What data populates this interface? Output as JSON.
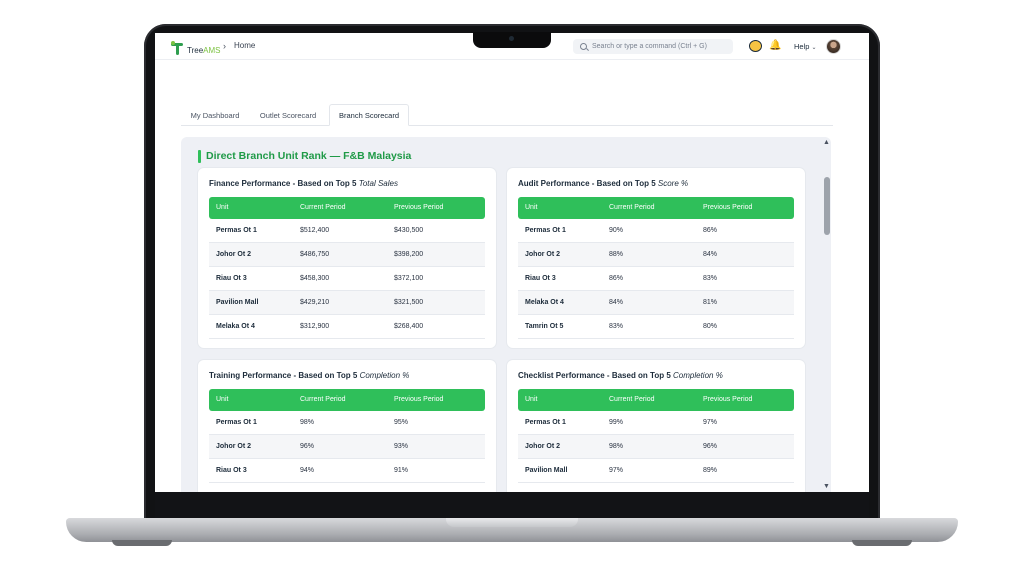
{
  "header": {
    "logo_text": "Tree",
    "logo_suffix": "AMS",
    "breadcrumb_sep": "›",
    "breadcrumb": "Home",
    "search_placeholder": "Search or type a command (Ctrl + G)",
    "help_label": "Help",
    "help_chevron": "⌄",
    "bell_glyph": "🔔"
  },
  "tabs": [
    {
      "label": "My Dashboard",
      "active": false
    },
    {
      "label": "Outlet Scorecard",
      "active": false
    },
    {
      "label": "Branch Scorecard",
      "active": true
    }
  ],
  "section_title": "Direct Branch Unit Rank — F&B Malaysia",
  "columns": [
    "Unit",
    "Current Period",
    "Previous Period"
  ],
  "cards": [
    {
      "title": "Finance Performance - Based on Top 5",
      "metric": "Total Sales",
      "rows": [
        [
          "Permas Ot 1",
          "$512,400",
          "$430,500"
        ],
        [
          "Johor Ot 2",
          "$486,750",
          "$398,200"
        ],
        [
          "Riau Ot 3",
          "$458,300",
          "$372,100"
        ],
        [
          "Pavilion Mall",
          "$429,210",
          "$321,500"
        ],
        [
          "Melaka Ot 4",
          "$312,900",
          "$268,400"
        ]
      ]
    },
    {
      "title": "Audit Performance - Based on Top 5",
      "metric": "Score %",
      "rows": [
        [
          "Permas Ot 1",
          "90%",
          "86%"
        ],
        [
          "Johor Ot 2",
          "88%",
          "84%"
        ],
        [
          "Riau Ot 3",
          "86%",
          "83%"
        ],
        [
          "Melaka Ot 4",
          "84%",
          "81%"
        ],
        [
          "Tamrin Ot 5",
          "83%",
          "80%"
        ]
      ]
    },
    {
      "title": "Training Performance - Based on Top 5",
      "metric": "Completion %",
      "rows": [
        [
          "Permas Ot 1",
          "98%",
          "95%"
        ],
        [
          "Johor Ot 2",
          "96%",
          "93%"
        ],
        [
          "Riau Ot 3",
          "94%",
          "91%"
        ]
      ]
    },
    {
      "title": "Checklist Performance - Based on Top 5",
      "metric": "Completion %",
      "rows": [
        [
          "Permas Ot 1",
          "99%",
          "97%"
        ],
        [
          "Johor Ot 2",
          "98%",
          "96%"
        ],
        [
          "Pavilion Mall",
          "97%",
          "89%"
        ]
      ]
    }
  ],
  "scrollbar": {
    "up": "▲",
    "down": "▼"
  },
  "colors": {
    "accent": "#2fbf5a",
    "title_green": "#1f9a47",
    "panel_bg": "#eef0f5"
  }
}
